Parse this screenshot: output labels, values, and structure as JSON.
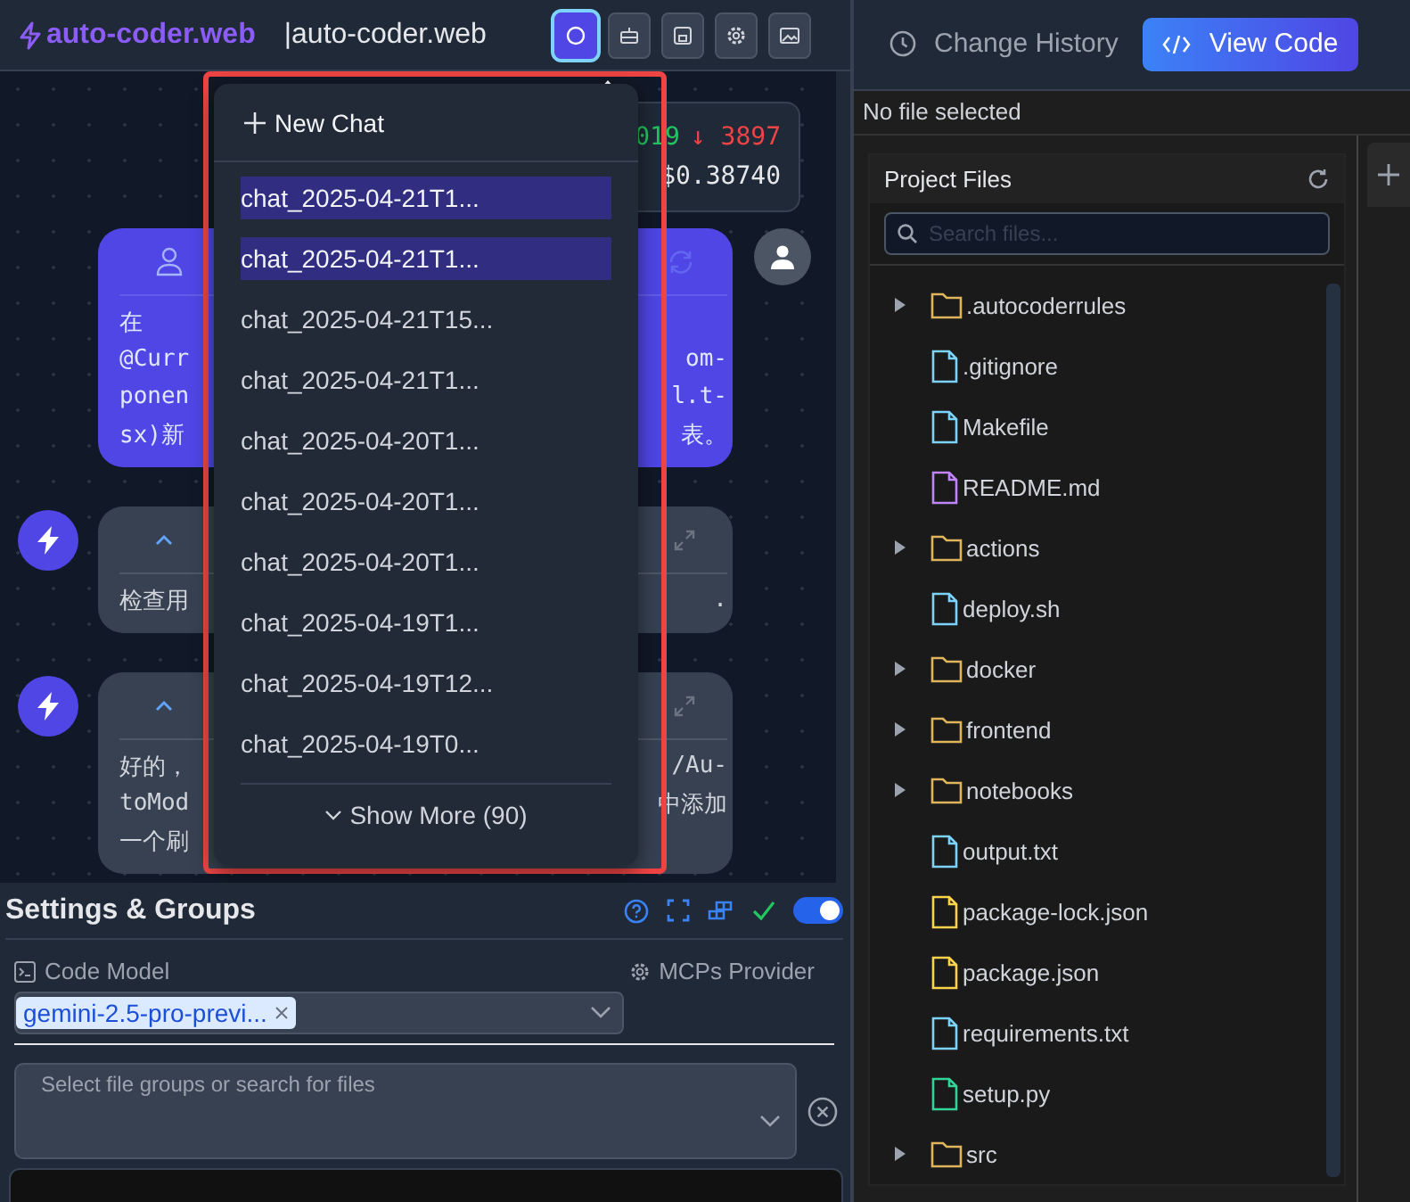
{
  "header": {
    "logo": "auto-coder.web",
    "project": "|auto-coder.web",
    "tools": [
      {
        "kind": "chat",
        "selected": true
      },
      {
        "kind": "robot",
        "selected": false
      },
      {
        "kind": "save",
        "selected": false
      },
      {
        "kind": "settings",
        "selected": false
      },
      {
        "kind": "image",
        "selected": false
      }
    ]
  },
  "stats": {
    "line_1": [
      {
        "text": "019",
        "color": "#22c55e"
      },
      {
        "text": "↓ 3897",
        "color": "#ef4444"
      }
    ],
    "line_2": "$0.38740"
  },
  "messages": [
    {
      "kind": "user",
      "lines": [
        {
          "left": "在"
        },
        {
          "left": "@Curr",
          "right": "om-"
        },
        {
          "left": "ponen",
          "right": "l.t-"
        },
        {
          "left": "sx)新",
          "right": "表。"
        }
      ]
    },
    {
      "kind": "assistant",
      "lines": [
        {
          "left": "检查用",
          "right": "."
        }
      ]
    },
    {
      "kind": "assistant",
      "lines": [
        {
          "left": "好的，",
          "right": "/Au-"
        },
        {
          "left": "toMod",
          "right": "中添加"
        },
        {
          "left": "一个刷"
        }
      ]
    }
  ],
  "chat_menu": {
    "new_chat": "New Chat",
    "items": [
      {
        "label": "chat_2025-04-21T1...",
        "selected": true
      },
      {
        "label": "chat_2025-04-21T1...",
        "selected": true
      },
      {
        "label": "chat_2025-04-21T15...",
        "selected": false
      },
      {
        "label": "chat_2025-04-21T1...",
        "selected": false
      },
      {
        "label": "chat_2025-04-20T1...",
        "selected": false
      },
      {
        "label": "chat_2025-04-20T1...",
        "selected": false
      },
      {
        "label": "chat_2025-04-20T1...",
        "selected": false
      },
      {
        "label": "chat_2025-04-19T1...",
        "selected": false
      },
      {
        "label": "chat_2025-04-19T12...",
        "selected": false
      },
      {
        "label": "chat_2025-04-19T0...",
        "selected": false
      }
    ],
    "show_more": "Show More (90)"
  },
  "settings": {
    "title": "Settings & Groups",
    "toggle_on": true,
    "code_model_label": "Code Model",
    "mcps_label": "MCPs Provider",
    "code_model": "gemini-2.5-pro-previ...",
    "file_groups_placeholder": "Select file groups or search for files"
  },
  "right_panel": {
    "history": "Change History",
    "view_code": "View Code",
    "status": "No file selected",
    "files_title": "Project Files",
    "search_placeholder": "Search files...",
    "tree": [
      {
        "name": ".autocoderrules",
        "kind": "folder"
      },
      {
        "name": ".gitignore",
        "kind": "file",
        "color": "#7dd3fc"
      },
      {
        "name": "Makefile",
        "kind": "file",
        "color": "#7dd3fc"
      },
      {
        "name": "README.md",
        "kind": "file",
        "color": "#c084fc"
      },
      {
        "name": "actions",
        "kind": "folder"
      },
      {
        "name": "deploy.sh",
        "kind": "file",
        "color": "#7dd3fc"
      },
      {
        "name": "docker",
        "kind": "folder"
      },
      {
        "name": "frontend",
        "kind": "folder"
      },
      {
        "name": "notebooks",
        "kind": "folder"
      },
      {
        "name": "output.txt",
        "kind": "file",
        "color": "#7dd3fc"
      },
      {
        "name": "package-lock.json",
        "kind": "file",
        "color": "#fcd34d"
      },
      {
        "name": "package.json",
        "kind": "file",
        "color": "#fcd34d"
      },
      {
        "name": "requirements.txt",
        "kind": "file",
        "color": "#7dd3fc"
      },
      {
        "name": "setup.py",
        "kind": "file",
        "color": "#34d399"
      },
      {
        "name": "src",
        "kind": "folder"
      }
    ]
  }
}
